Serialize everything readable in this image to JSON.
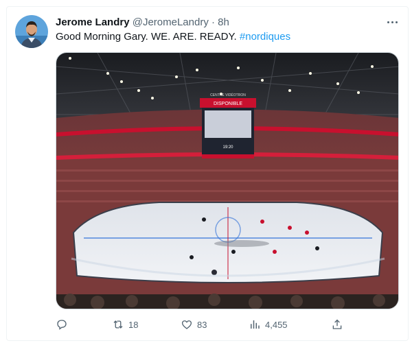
{
  "tweet": {
    "author_name": "Jerome Landry",
    "handle": "@JeromeLandry",
    "separator": "·",
    "time": "8h",
    "text": "Good Morning Gary. WE. ARE. READY.",
    "hashtag": "#nordiques"
  },
  "media": {
    "arena_signs": {
      "top_label": "CENTRE VIDÉOTRON",
      "banner": "DISPONIBLE",
      "score": "19:20"
    }
  },
  "actions": {
    "reply_count": "",
    "retweet_count": "18",
    "like_count": "83",
    "view_count": "4,455"
  },
  "colors": {
    "accent": "#1d9bf0",
    "muted": "#536471",
    "text": "#0f1419"
  },
  "icons": [
    "more-icon",
    "reply-icon",
    "retweet-icon",
    "like-icon",
    "views-icon",
    "share-icon"
  ]
}
